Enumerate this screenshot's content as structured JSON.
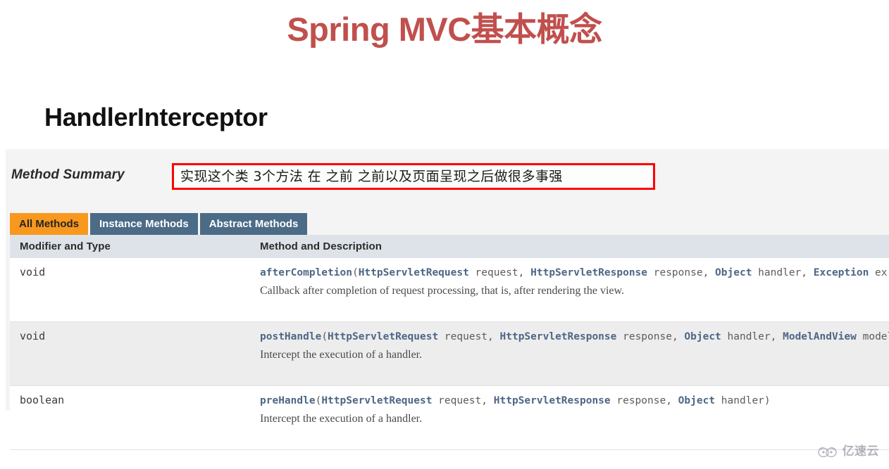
{
  "slide": {
    "title": "Spring MVC基本概念",
    "title_color": "#C0504D",
    "section_heading": "HandlerInterceptor"
  },
  "javadoc": {
    "summary_label": "Method Summary",
    "annotation": {
      "text": "实现这个类 3个方法 在 之前 之前以及页面呈现之后做很多事强",
      "border_color": "#FF0000"
    },
    "tabs": [
      {
        "label": "All Methods",
        "active": true,
        "color": "#F8981D"
      },
      {
        "label": "Instance Methods",
        "active": false,
        "color": "#4C6B87"
      },
      {
        "label": "Abstract Methods",
        "active": false,
        "color": "#4C6B87"
      }
    ],
    "columns": {
      "modifier": "Modifier and Type",
      "method": "Method and Description"
    },
    "rows": [
      {
        "modifier": "void",
        "method_name": "afterCompletion",
        "signature_open": "(",
        "params": [
          {
            "type": "HttpServletRequest",
            "name": " request, "
          },
          {
            "type": "HttpServletResponse",
            "name": " response, "
          },
          {
            "type": "Object",
            "name": " handler, "
          },
          {
            "type": "Exception",
            "name": " ex)"
          }
        ],
        "description": "Callback after completion of request processing, that is, after rendering the view."
      },
      {
        "modifier": "void",
        "method_name": "postHandle",
        "signature_open": "(",
        "params": [
          {
            "type": "HttpServletRequest",
            "name": " request, "
          },
          {
            "type": "HttpServletResponse",
            "name": " response, "
          },
          {
            "type": "Object",
            "name": " handler, "
          },
          {
            "type": "ModelAndView",
            "name": " modelAndView)"
          }
        ],
        "description": "Intercept the execution of a handler."
      },
      {
        "modifier": "boolean",
        "method_name": "preHandle",
        "signature_open": "(",
        "params": [
          {
            "type": "HttpServletRequest",
            "name": " request, "
          },
          {
            "type": "HttpServletResponse",
            "name": " response, "
          },
          {
            "type": "Object",
            "name": " handler)"
          }
        ],
        "description": "Intercept the execution of a handler."
      }
    ]
  },
  "watermark": {
    "text": "亿速云",
    "icon": "cloud-logo-icon",
    "color": "#9a9aa8"
  }
}
